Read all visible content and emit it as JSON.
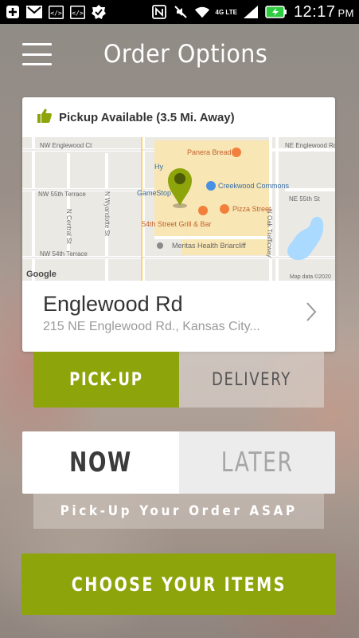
{
  "status_bar": {
    "time": "12:17",
    "ampm": "PM",
    "network": "4G LTE",
    "icons": [
      "plus-icon",
      "gmail-icon",
      "code-icon",
      "code-icon",
      "check-icon",
      "nfc-icon",
      "mute-icon",
      "wifi-icon",
      "signal-icon",
      "battery-charging-icon"
    ]
  },
  "header": {
    "title": "Order Options",
    "menu_icon": "hamburger-menu-icon"
  },
  "location_card": {
    "pickup_status": "Pickup Available (3.5 Mi. Away)",
    "status_icon": "thumbs-up-icon",
    "map": {
      "labels": {
        "panera": "Panera Bread",
        "ne_englewood": "NE Englewood Rd",
        "nw_englewood_ct": "NW Englewood Ct",
        "hy": "Hy",
        "creekwood": "Creekwood Commons",
        "gamestop": "GameStop",
        "nw_55th_terrace": "NW 55th Terrace",
        "n_wyandotte": "N Wyandotte St",
        "ne_55th": "NE 55th St",
        "pizza_street": "Pizza Street",
        "grill_bar": "54th Street Grill & Bar",
        "n_central": "N Central St",
        "n_oak": "N Oak Trafficway",
        "meritas": "Meritas Health Briarcliff",
        "nw_54th_terrace": "NW 54th Terrace",
        "google": "Google",
        "map_data": "Map data ©2020"
      }
    },
    "store_name": "Englewood Rd",
    "store_address": "215 NE Englewood Rd., Kansas City...",
    "chevron_icon": "chevron-right-icon"
  },
  "order_method": {
    "pickup_label": "PICK-UP",
    "delivery_label": "DELIVERY",
    "selected": "PICK-UP"
  },
  "order_time": {
    "now_label": "NOW",
    "later_label": "LATER",
    "selected": "NOW",
    "note": "Pick-Up Your Order ASAP"
  },
  "cta": {
    "label": "CHOOSE YOUR ITEMS"
  },
  "colors": {
    "accent": "#8ea40b",
    "status_bar": "#000000",
    "card": "#ffffff"
  }
}
